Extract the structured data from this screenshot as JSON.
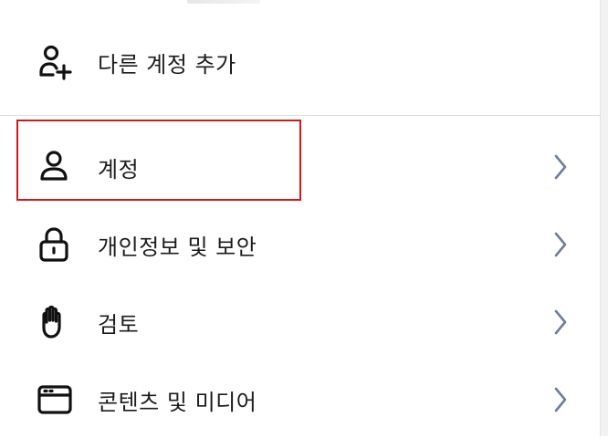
{
  "menu": {
    "add_account": {
      "label": "다른 계정 추가",
      "icon": "add-user-icon"
    },
    "items": [
      {
        "label": "계정",
        "icon": "person-icon"
      },
      {
        "label": "개인정보 및 보안",
        "icon": "lock-icon"
      },
      {
        "label": "검토",
        "icon": "hand-icon"
      },
      {
        "label": "콘텐츠 및 미디어",
        "icon": "browser-window-icon"
      }
    ]
  },
  "colors": {
    "highlight": "#d6151b",
    "chevron": "#6f7e99",
    "divider": "#dcdcdc"
  }
}
